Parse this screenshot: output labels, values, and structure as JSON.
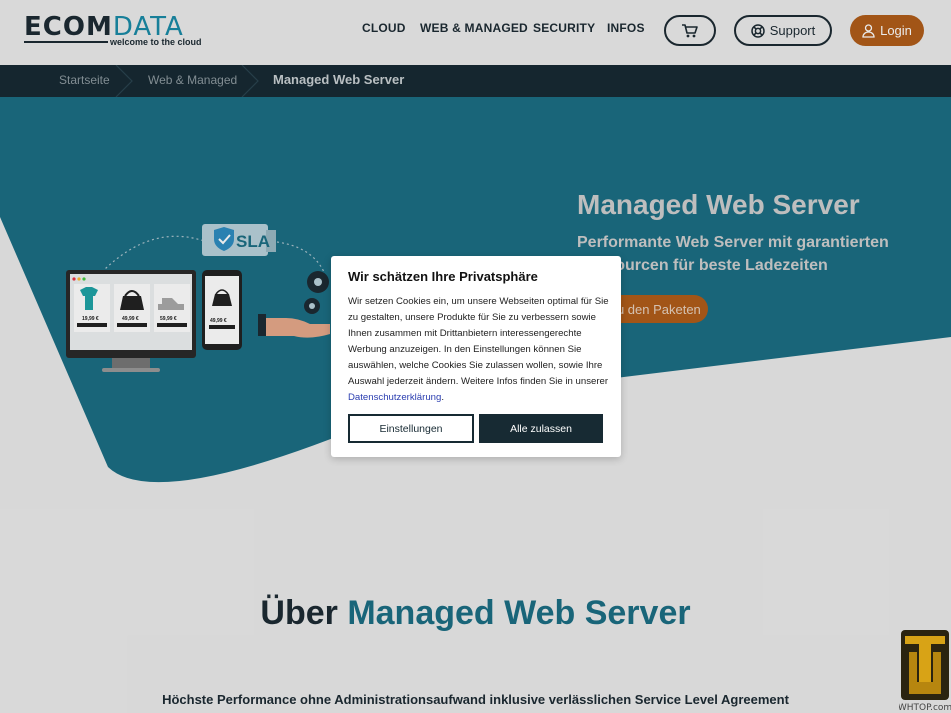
{
  "brand": {
    "name_part1": "ECOM",
    "name_part2": "DATA",
    "tagline": "welcome to the cloud"
  },
  "nav": [
    {
      "label": "CLOUD"
    },
    {
      "label": "WEB & MANAGED"
    },
    {
      "label": "SECURITY"
    },
    {
      "label": "INFOS"
    }
  ],
  "header_buttons": {
    "support": "Support",
    "login": "Login",
    "cart_icon": "cart-icon"
  },
  "breadcrumb": [
    "Startseite",
    "Web & Managed",
    "Managed Web Server"
  ],
  "hero": {
    "title": "Managed Web Server",
    "subtitle": "Performante Web Server mit garantierten Ressourcen für beste Ladezeiten",
    "button": "Zu den Paketen",
    "sla_label": "SLA",
    "prices": [
      "19,99 €",
      "49,99 €",
      "59,99 €",
      "49,99 €"
    ]
  },
  "cookie": {
    "title": "Wir schätzen Ihre Privatsphäre",
    "text": "Wir setzen Cookies ein, um unsere Webseiten optimal für Sie zu gestalten, unsere Produkte für Sie zu verbessern sowie Ihnen zusammen mit Drittanbietern interessengerechte Werbung anzuzeigen. In den Einstellungen können Sie auswählen, welche Cookies Sie zulassen wollen, sowie Ihre Auswahl jederzeit ändern. Weitere Infos finden Sie in unserer",
    "link": "Datenschutzerklärung",
    "link_suffix": ".",
    "settings_button": "Einstellungen",
    "accept_button": "Alle zulassen"
  },
  "about": {
    "prefix": "Über",
    "title": "Managed Web Server"
  },
  "tagline": "Höchste Performance ohne Administrationsaufwand inklusive verlässlichen Service Level Agreement",
  "watermark": {
    "text": "WHTOP.com"
  },
  "colors": {
    "accent": "#1a8aa6",
    "hero_bg": "#1c6e84",
    "dark": "#172a33",
    "orange": "#b05d1a"
  }
}
